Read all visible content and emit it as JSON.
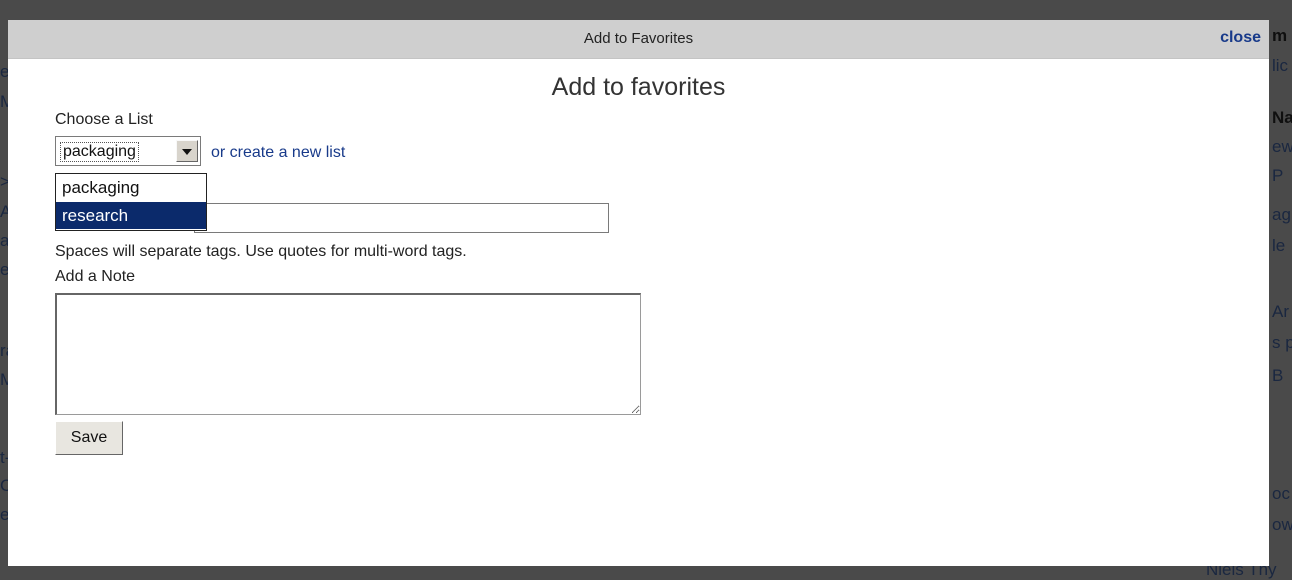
{
  "dialog": {
    "titlebar": "Add to Favorites",
    "close_label": "close",
    "heading": "Add to favorites"
  },
  "list": {
    "label": "Choose a List",
    "selected": "packaging",
    "create_link": "or create a new list",
    "options": [
      {
        "label": "packaging",
        "highlighted": false
      },
      {
        "label": "research",
        "highlighted": true
      }
    ]
  },
  "tags": {
    "value": "",
    "hint": "Spaces will separate tags. Use quotes for multi-word tags."
  },
  "note": {
    "label": "Add a Note",
    "value": ""
  },
  "save_label": "Save",
  "colors": {
    "link": "#183a8a",
    "highlight": "#0b2a6b",
    "titlebar": "#cfcfcf"
  },
  "background_fragments": {
    "left": [
      "eb",
      "M",
      ">",
      "A",
      "ar",
      "e",
      "ra",
      "M",
      "t-",
      "C",
      "el"
    ],
    "right": [
      "m",
      "lic",
      "Na",
      "ew",
      "P",
      "ag",
      "le",
      "Ar",
      "s p",
      "B",
      "oc",
      "ow"
    ],
    "bottom": "Niels Thy"
  }
}
